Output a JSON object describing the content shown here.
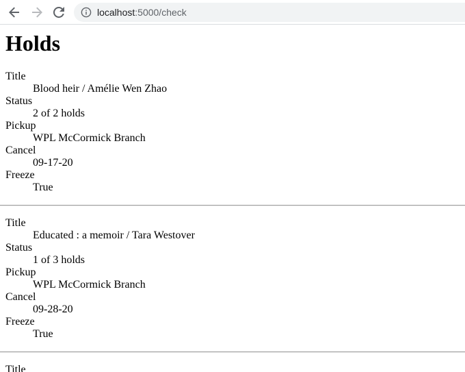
{
  "browser": {
    "url_host": "localhost",
    "url_rest": ":5000/check"
  },
  "page": {
    "title": "Holds"
  },
  "labels": {
    "title": "Title",
    "status": "Status",
    "pickup": "Pickup",
    "cancel": "Cancel",
    "freeze": "Freeze"
  },
  "holds": [
    {
      "title": "Blood heir / Amélie Wen Zhao",
      "status": "2 of 2 holds",
      "pickup": "WPL McCormick Branch",
      "cancel": "09-17-20",
      "freeze": "True"
    },
    {
      "title": "Educated : a memoir / Tara Westover",
      "status": "1 of 3 holds",
      "pickup": "WPL McCormick Branch",
      "cancel": "09-28-20",
      "freeze": "True"
    }
  ],
  "partial_next": {
    "label": "Title"
  }
}
